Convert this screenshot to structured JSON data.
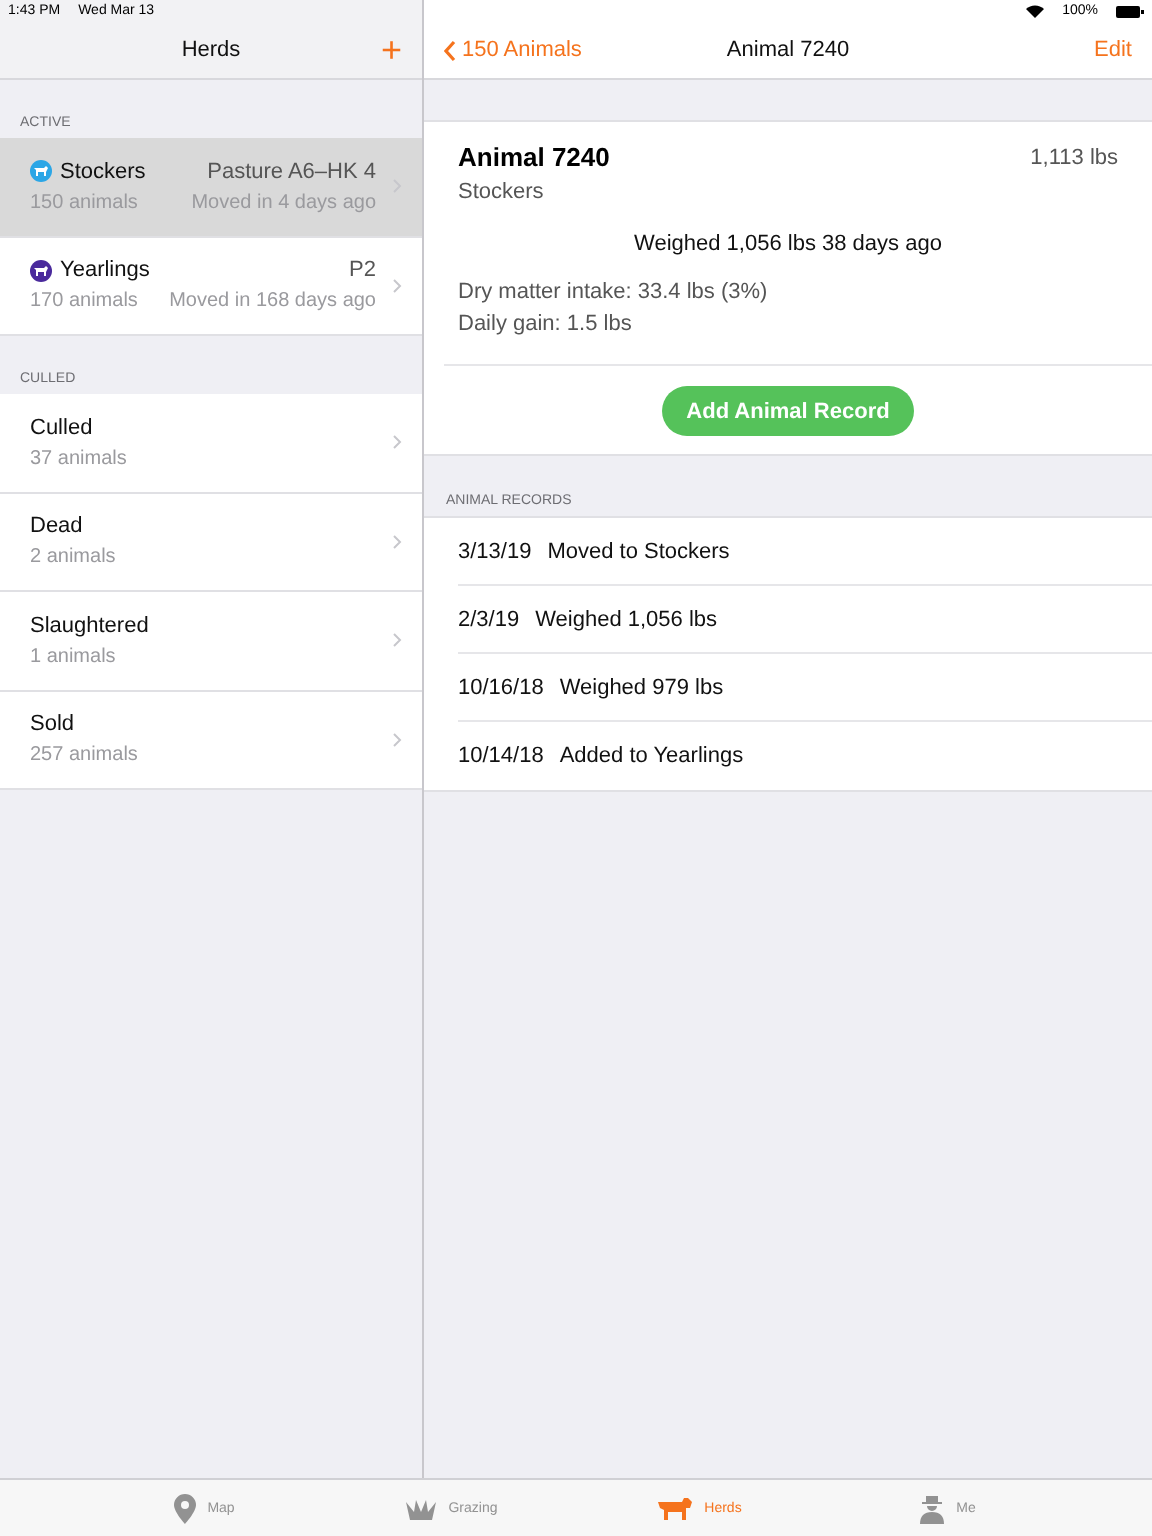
{
  "status_bar": {
    "time": "1:43 PM",
    "date": "Wed Mar 13",
    "battery": "100%"
  },
  "sidebar": {
    "title": "Herds",
    "add": "+",
    "sections": [
      {
        "header": "ACTIVE",
        "items": [
          {
            "name": "Stockers",
            "count": "150 animals",
            "location": "Pasture A6–HK 4",
            "moved": "Moved in 4 days ago",
            "color": "#2ba6e6",
            "selected": true
          },
          {
            "name": "Yearlings",
            "count": "170 animals",
            "location": "P2",
            "moved": "Moved in 168 days ago",
            "color": "#4a2a9c",
            "selected": false
          }
        ]
      },
      {
        "header": "CULLED",
        "items": [
          {
            "name": "Culled",
            "count": "37 animals",
            "selected": false
          },
          {
            "name": "Dead",
            "count": "2 animals",
            "selected": false
          },
          {
            "name": "Slaughtered",
            "count": "1 animals",
            "selected": false
          },
          {
            "name": "Sold",
            "count": "257 animals",
            "selected": false
          }
        ]
      }
    ]
  },
  "detail": {
    "back": "150 Animals",
    "title": "Animal 7240",
    "edit": "Edit",
    "card": {
      "name": "Animal 7240",
      "weight": "1,113 lbs",
      "herd": "Stockers",
      "weighed": "Weighed 1,056 lbs 38 days ago",
      "stats": [
        "Dry matter intake: 33.4 lbs (3%)",
        "Daily gain: 1.5 lbs"
      ],
      "button": "Add Animal Record"
    },
    "records_header": "ANIMAL RECORDS",
    "records": [
      {
        "date": "3/13/19",
        "text": "Moved to Stockers"
      },
      {
        "date": "2/3/19",
        "text": "Weighed 1,056 lbs"
      },
      {
        "date": "10/16/18",
        "text": "Weighed 979 lbs"
      },
      {
        "date": "10/14/18",
        "text": "Added to Yearlings"
      }
    ]
  },
  "tab_bar": [
    {
      "label": "Map",
      "kind": "pin",
      "selected": false
    },
    {
      "label": "Grazing",
      "kind": "grass",
      "selected": false
    },
    {
      "label": "Herds",
      "kind": "cow",
      "selected": true
    },
    {
      "label": "Me",
      "kind": "person",
      "selected": false
    }
  ]
}
